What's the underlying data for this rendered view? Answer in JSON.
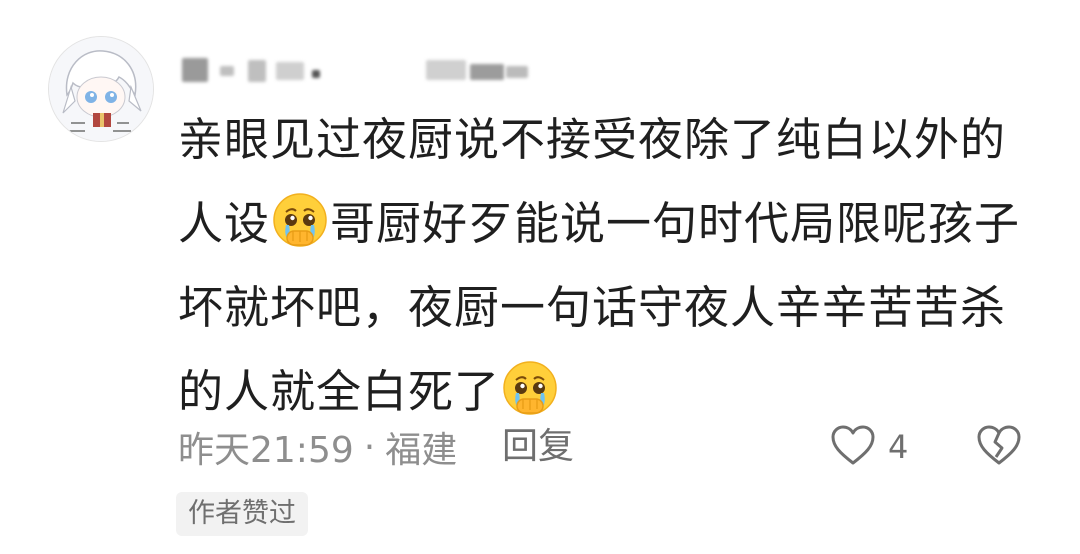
{
  "comment": {
    "body": {
      "part1": "亲眼见过夜厨说不接受夜除了纯白以外的人设",
      "emoji1": "crying-pleading-face",
      "part2": "哥厨好歹能说一句时代局限呢孩子坏就坏吧，夜厨一句话守夜人辛辛苦苦杀的人就全白死了",
      "emoji2": "crying-pleading-face"
    },
    "meta": {
      "time": "昨天21:59",
      "separator": "·",
      "location": "福建"
    },
    "reply_label": "回复",
    "like_count": "4",
    "author_liked_badge": "作者赞过"
  },
  "colors": {
    "text": "#1f1f1f",
    "muted": "#8e8e8e",
    "badge_bg": "#f2f2f2"
  }
}
